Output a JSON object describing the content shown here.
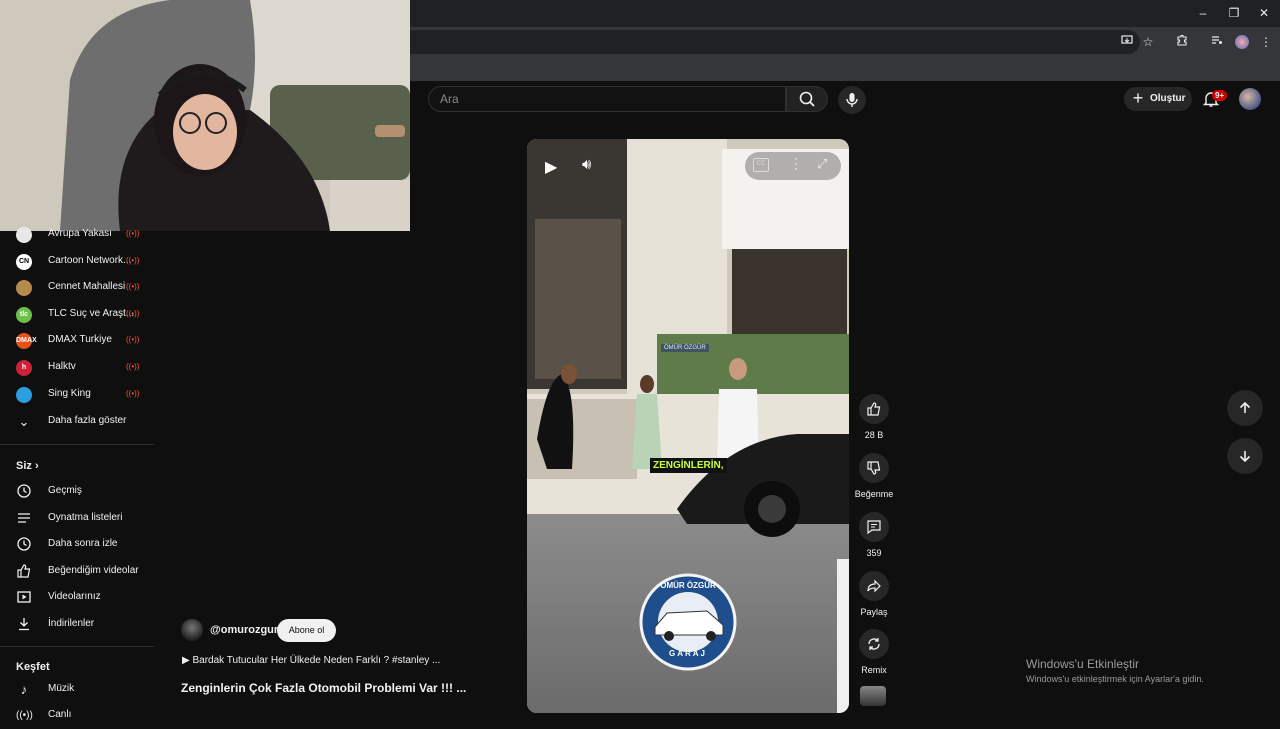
{
  "browser": {
    "window_controls": {
      "minimize": "–",
      "restore": "❐",
      "close": "✕"
    }
  },
  "header": {
    "search_placeholder": "Ara",
    "create_label": "Oluştur",
    "notification_count": "9+"
  },
  "sidebar": {
    "subscriptions": [
      {
        "label": "Avrupa Yakası",
        "icon_text": "",
        "icon_color": "#e8e8e8",
        "live": true
      },
      {
        "label": "Cartoon Network...",
        "icon_text": "CN",
        "icon_color": "#ffffff",
        "live": true
      },
      {
        "label": "Cennet Mahallesi",
        "icon_text": "",
        "icon_color": "#b58a4a",
        "live": true
      },
      {
        "label": "TLC Suç ve Araşt...",
        "icon_text": "tlc",
        "icon_color": "#6cc04a",
        "live": true
      },
      {
        "label": "DMAX Turkiye",
        "icon_text": "DMAX",
        "icon_color": "#e8501a",
        "live": true
      },
      {
        "label": "Halktv",
        "icon_text": "h",
        "icon_color": "#d0213a",
        "live": true
      },
      {
        "label": "Sing King",
        "icon_text": "",
        "icon_color": "#2b9fe0",
        "live": true
      }
    ],
    "show_more": "Daha fazla göster",
    "you_heading": "Siz",
    "you_items": [
      {
        "label": "Geçmiş",
        "icon": "history-icon"
      },
      {
        "label": "Oynatma listeleri",
        "icon": "playlists-icon"
      },
      {
        "label": "Daha sonra izle",
        "icon": "watch-later-icon"
      },
      {
        "label": "Beğendiğim videolar",
        "icon": "liked-icon"
      },
      {
        "label": "Videolarınız",
        "icon": "your-videos-icon"
      },
      {
        "label": "İndirilenler",
        "icon": "download-icon"
      }
    ],
    "explore_heading": "Keşfet",
    "explore_items": [
      {
        "label": "Müzik",
        "icon": "music-icon"
      },
      {
        "label": "Canlı",
        "icon": "live-icon"
      }
    ]
  },
  "video": {
    "overlay_brand": "ÖMÜR ÖZGÜR",
    "caption": "ZENGİNLERİN,",
    "logo_top": "ÖMÜR ÖZGÜR",
    "logo_bottom": "GARAJ"
  },
  "actions": {
    "likes": "28 B",
    "dislike": "Beğenme",
    "comments": "359",
    "share": "Paylaş",
    "remix": "Remix"
  },
  "channel": {
    "handle": "@omurozgur",
    "subscribe": "Abone ol",
    "related": "▶ Bardak Tutucular Her Ülkede Neden Farklı ? #stanley ...",
    "title": "Zenginlerin Çok Fazla Otomobil Problemi Var !!! ..."
  },
  "watermark": {
    "line1": "Windows'u Etkinleştir",
    "line2": "Windows'u etkinleştirmek için Ayarlar'a gidin."
  }
}
